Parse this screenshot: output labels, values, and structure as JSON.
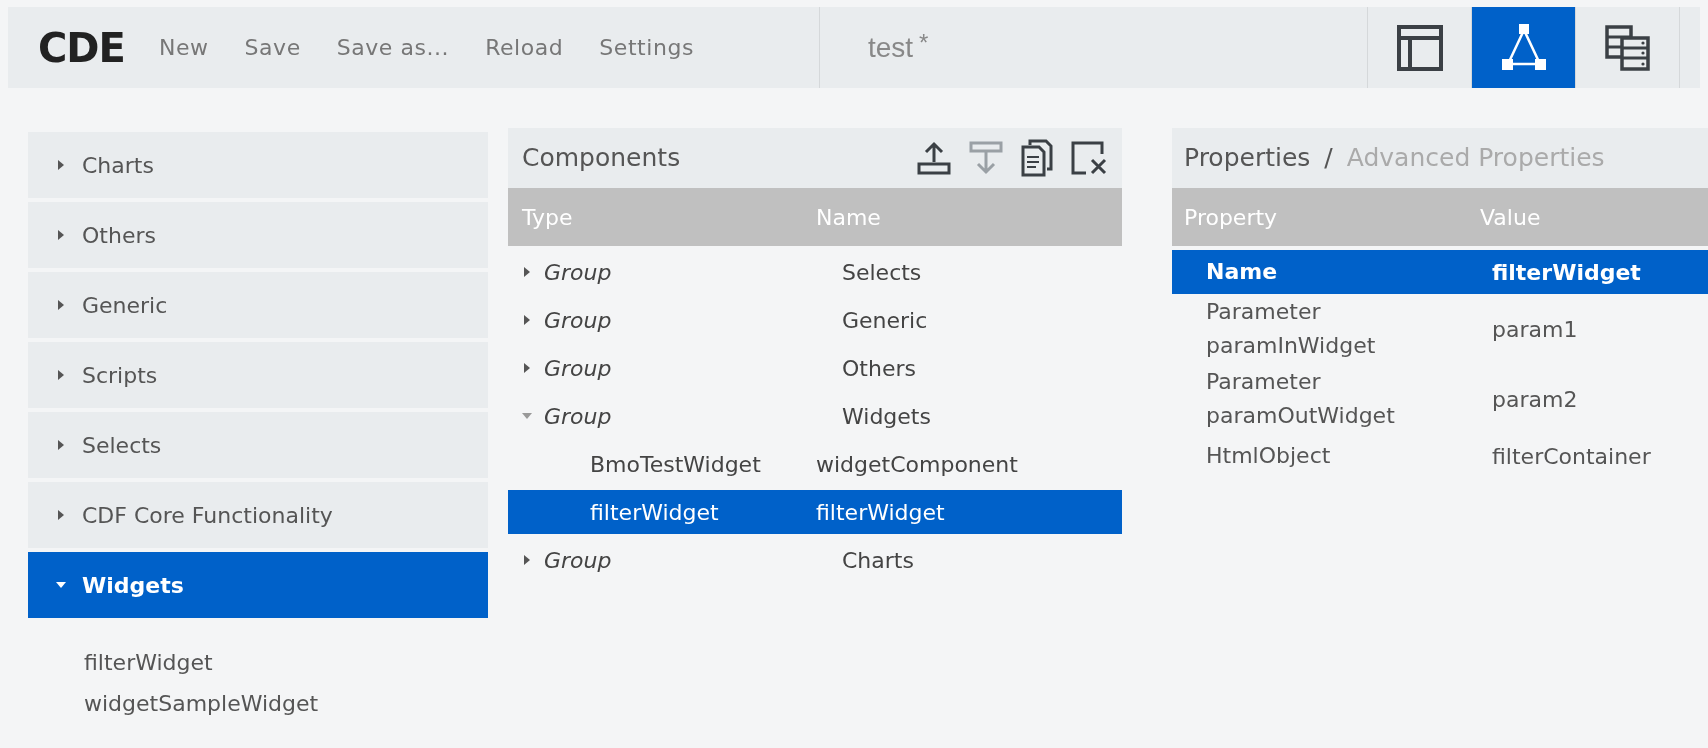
{
  "header": {
    "logo": "CDE",
    "menu": [
      "New",
      "Save",
      "Save as...",
      "Reload",
      "Settings"
    ],
    "title": "test",
    "modified_mark": "*",
    "view_buttons": [
      {
        "kind": "layout",
        "selected": false
      },
      {
        "kind": "components",
        "selected": true
      },
      {
        "kind": "datasources",
        "selected": false
      }
    ]
  },
  "sidebar": {
    "groups": [
      {
        "label": "Charts",
        "expanded": false
      },
      {
        "label": "Others",
        "expanded": false
      },
      {
        "label": "Generic",
        "expanded": false
      },
      {
        "label": "Scripts",
        "expanded": false
      },
      {
        "label": "Selects",
        "expanded": false
      },
      {
        "label": "CDF Core Functionality",
        "expanded": false
      },
      {
        "label": "Widgets",
        "expanded": true,
        "children": [
          "filterWidget",
          "widgetSampleWidget"
        ]
      }
    ]
  },
  "components": {
    "title": "Components",
    "tools": [
      {
        "kind": "move-up",
        "disabled": false
      },
      {
        "kind": "move-down",
        "disabled": true
      },
      {
        "kind": "duplicate",
        "disabled": false
      },
      {
        "kind": "delete",
        "disabled": false
      }
    ],
    "columns": [
      "Type",
      "Name"
    ],
    "rows": [
      {
        "kind": "group",
        "type": "Group",
        "name": "Selects",
        "expanded": false,
        "selected": false
      },
      {
        "kind": "group",
        "type": "Group",
        "name": "Generic",
        "expanded": false,
        "selected": false
      },
      {
        "kind": "group",
        "type": "Group",
        "name": "Others",
        "expanded": false,
        "selected": false
      },
      {
        "kind": "group",
        "type": "Group",
        "name": "Widgets",
        "expanded": true,
        "selected": false,
        "children": [
          {
            "kind": "component",
            "type": "BmoTestWidget",
            "name": "widgetComponent",
            "selected": false
          },
          {
            "kind": "component",
            "type": "filterWidget",
            "name": "filterWidget",
            "selected": true
          }
        ]
      },
      {
        "kind": "group",
        "type": "Group",
        "name": "Charts",
        "expanded": false,
        "selected": false
      }
    ]
  },
  "properties": {
    "tabs": [
      {
        "label": "Properties",
        "selected": true
      },
      {
        "label": "Advanced Properties",
        "selected": false
      }
    ],
    "separator": "/",
    "columns": [
      "Property",
      "Value"
    ],
    "rows": [
      {
        "property": "Name",
        "value": "filterWidget",
        "selected": true
      },
      {
        "property": "Parameter paramInWidget",
        "value": "param1",
        "selected": false
      },
      {
        "property": "Parameter paramOutWidget",
        "value": "param2",
        "selected": false
      },
      {
        "property": "HtmlObject",
        "value": "filterContainer",
        "selected": false
      }
    ]
  }
}
